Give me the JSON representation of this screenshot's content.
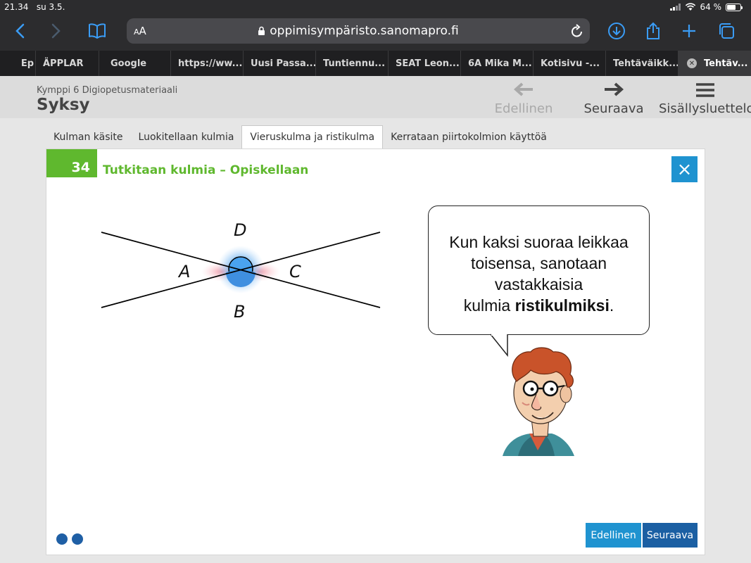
{
  "status": {
    "time": "21.34",
    "date": "su 3.5.",
    "battery": "64 %",
    "battery_level": 0.64
  },
  "browser": {
    "text_size_label_small": "A",
    "text_size_label_large": "A",
    "url": "oppimisympäristo.sanomapro.fi",
    "tabs": [
      {
        "label": "Ep"
      },
      {
        "label": "ÄPPLAR"
      },
      {
        "label": "Google"
      },
      {
        "label": "https://ww..."
      },
      {
        "label": "Uusi Passa..."
      },
      {
        "label": "Tuntiennu..."
      },
      {
        "label": "SEAT Leon..."
      },
      {
        "label": "6A Mika M..."
      },
      {
        "label": "Kotisivu -..."
      },
      {
        "label": "Tehtäväikk..."
      },
      {
        "label": "Tehtäv..."
      }
    ],
    "accent_color": "#3a9cf5"
  },
  "header": {
    "kicker": "Kymppi 6 Digiopetusmateriaali",
    "book_title": "Syksy",
    "prev_label": "Edellinen",
    "next_label": "Seuraava",
    "toc_label": "Sisällysluettelo"
  },
  "section_tabs": [
    {
      "label": "Kulman käsite"
    },
    {
      "label": "Luokitellaan kulmia"
    },
    {
      "label": "Vieruskulma ja ristikulma"
    },
    {
      "label": "Kerrataan piirtokolmion käyttöä"
    }
  ],
  "card": {
    "number": "34",
    "title": "Tutkitaan kulmia – Opiskellaan",
    "close_symbol": "×",
    "diagram": {
      "label_top": "D",
      "label_left": "A",
      "label_right": "C",
      "label_bottom": "B"
    },
    "bubble": {
      "line1": "Kun kaksi suoraa leikkaa",
      "line2": "toisensa, sanotaan",
      "line3": "vastakkaisia",
      "line4_prefix": "kulmia ",
      "line4_bold": "ristikulmiksi",
      "line4_suffix": "."
    },
    "prev_button": "Edellinen",
    "next_button": "Seuraava",
    "colors": {
      "green": "#5fb82e",
      "blue": "#1f93d0",
      "dark_blue": "#1b5fa3"
    }
  }
}
